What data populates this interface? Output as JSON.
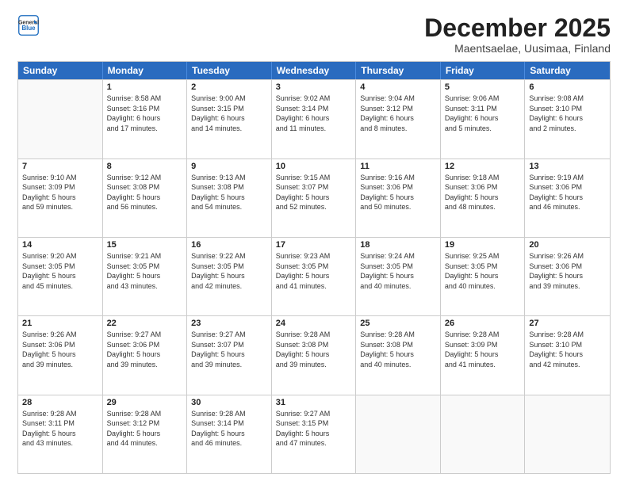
{
  "logo": {
    "general": "General",
    "blue": "Blue"
  },
  "header": {
    "month": "December 2025",
    "location": "Maentsaelae, Uusimaa, Finland"
  },
  "days": [
    "Sunday",
    "Monday",
    "Tuesday",
    "Wednesday",
    "Thursday",
    "Friday",
    "Saturday"
  ],
  "weeks": [
    [
      {
        "date": "",
        "info": ""
      },
      {
        "date": "1",
        "info": "Sunrise: 8:58 AM\nSunset: 3:16 PM\nDaylight: 6 hours\nand 17 minutes."
      },
      {
        "date": "2",
        "info": "Sunrise: 9:00 AM\nSunset: 3:15 PM\nDaylight: 6 hours\nand 14 minutes."
      },
      {
        "date": "3",
        "info": "Sunrise: 9:02 AM\nSunset: 3:14 PM\nDaylight: 6 hours\nand 11 minutes."
      },
      {
        "date": "4",
        "info": "Sunrise: 9:04 AM\nSunset: 3:12 PM\nDaylight: 6 hours\nand 8 minutes."
      },
      {
        "date": "5",
        "info": "Sunrise: 9:06 AM\nSunset: 3:11 PM\nDaylight: 6 hours\nand 5 minutes."
      },
      {
        "date": "6",
        "info": "Sunrise: 9:08 AM\nSunset: 3:10 PM\nDaylight: 6 hours\nand 2 minutes."
      }
    ],
    [
      {
        "date": "7",
        "info": "Sunrise: 9:10 AM\nSunset: 3:09 PM\nDaylight: 5 hours\nand 59 minutes."
      },
      {
        "date": "8",
        "info": "Sunrise: 9:12 AM\nSunset: 3:08 PM\nDaylight: 5 hours\nand 56 minutes."
      },
      {
        "date": "9",
        "info": "Sunrise: 9:13 AM\nSunset: 3:08 PM\nDaylight: 5 hours\nand 54 minutes."
      },
      {
        "date": "10",
        "info": "Sunrise: 9:15 AM\nSunset: 3:07 PM\nDaylight: 5 hours\nand 52 minutes."
      },
      {
        "date": "11",
        "info": "Sunrise: 9:16 AM\nSunset: 3:06 PM\nDaylight: 5 hours\nand 50 minutes."
      },
      {
        "date": "12",
        "info": "Sunrise: 9:18 AM\nSunset: 3:06 PM\nDaylight: 5 hours\nand 48 minutes."
      },
      {
        "date": "13",
        "info": "Sunrise: 9:19 AM\nSunset: 3:06 PM\nDaylight: 5 hours\nand 46 minutes."
      }
    ],
    [
      {
        "date": "14",
        "info": "Sunrise: 9:20 AM\nSunset: 3:05 PM\nDaylight: 5 hours\nand 45 minutes."
      },
      {
        "date": "15",
        "info": "Sunrise: 9:21 AM\nSunset: 3:05 PM\nDaylight: 5 hours\nand 43 minutes."
      },
      {
        "date": "16",
        "info": "Sunrise: 9:22 AM\nSunset: 3:05 PM\nDaylight: 5 hours\nand 42 minutes."
      },
      {
        "date": "17",
        "info": "Sunrise: 9:23 AM\nSunset: 3:05 PM\nDaylight: 5 hours\nand 41 minutes."
      },
      {
        "date": "18",
        "info": "Sunrise: 9:24 AM\nSunset: 3:05 PM\nDaylight: 5 hours\nand 40 minutes."
      },
      {
        "date": "19",
        "info": "Sunrise: 9:25 AM\nSunset: 3:05 PM\nDaylight: 5 hours\nand 40 minutes."
      },
      {
        "date": "20",
        "info": "Sunrise: 9:26 AM\nSunset: 3:06 PM\nDaylight: 5 hours\nand 39 minutes."
      }
    ],
    [
      {
        "date": "21",
        "info": "Sunrise: 9:26 AM\nSunset: 3:06 PM\nDaylight: 5 hours\nand 39 minutes."
      },
      {
        "date": "22",
        "info": "Sunrise: 9:27 AM\nSunset: 3:06 PM\nDaylight: 5 hours\nand 39 minutes."
      },
      {
        "date": "23",
        "info": "Sunrise: 9:27 AM\nSunset: 3:07 PM\nDaylight: 5 hours\nand 39 minutes."
      },
      {
        "date": "24",
        "info": "Sunrise: 9:28 AM\nSunset: 3:08 PM\nDaylight: 5 hours\nand 39 minutes."
      },
      {
        "date": "25",
        "info": "Sunrise: 9:28 AM\nSunset: 3:08 PM\nDaylight: 5 hours\nand 40 minutes."
      },
      {
        "date": "26",
        "info": "Sunrise: 9:28 AM\nSunset: 3:09 PM\nDaylight: 5 hours\nand 41 minutes."
      },
      {
        "date": "27",
        "info": "Sunrise: 9:28 AM\nSunset: 3:10 PM\nDaylight: 5 hours\nand 42 minutes."
      }
    ],
    [
      {
        "date": "28",
        "info": "Sunrise: 9:28 AM\nSunset: 3:11 PM\nDaylight: 5 hours\nand 43 minutes."
      },
      {
        "date": "29",
        "info": "Sunrise: 9:28 AM\nSunset: 3:12 PM\nDaylight: 5 hours\nand 44 minutes."
      },
      {
        "date": "30",
        "info": "Sunrise: 9:28 AM\nSunset: 3:14 PM\nDaylight: 5 hours\nand 46 minutes."
      },
      {
        "date": "31",
        "info": "Sunrise: 9:27 AM\nSunset: 3:15 PM\nDaylight: 5 hours\nand 47 minutes."
      },
      {
        "date": "",
        "info": ""
      },
      {
        "date": "",
        "info": ""
      },
      {
        "date": "",
        "info": ""
      }
    ]
  ]
}
